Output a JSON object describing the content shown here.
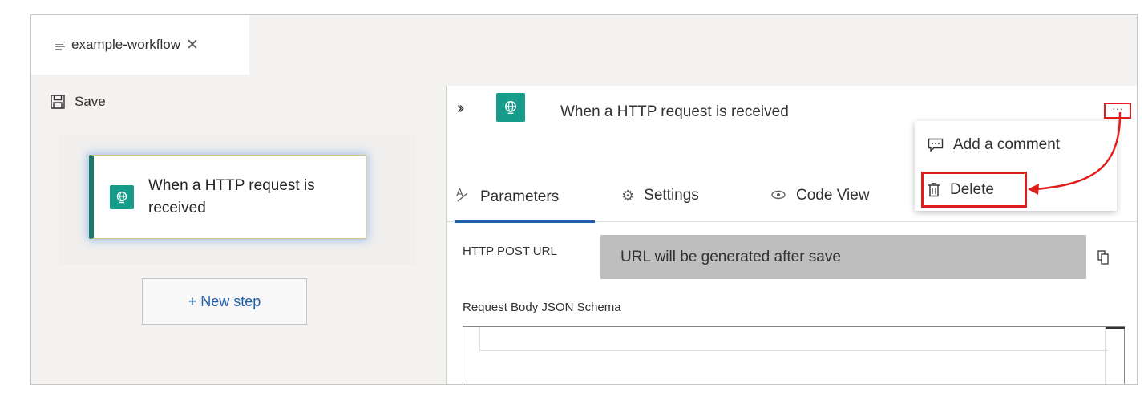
{
  "tab": {
    "title": "example-workflow",
    "close_glyph": "✕"
  },
  "toolbar": {
    "save_label": "Save"
  },
  "designer": {
    "trigger_card_title": "When a HTTP request is received",
    "new_step_label": "+ New step"
  },
  "details": {
    "collapse_glyph": "››",
    "title": "When a HTTP request is received",
    "more_glyph": "···",
    "tabs": [
      {
        "label": "Parameters",
        "icon": "parameters-icon"
      },
      {
        "label": "Settings",
        "icon": "settings-gear-icon"
      },
      {
        "label": "Code View",
        "icon": "eye-icon"
      }
    ],
    "http_post_url_label": "HTTP POST URL",
    "http_post_url_value": "URL will be generated after save",
    "schema_label": "Request Body JSON Schema"
  },
  "menu": {
    "items": [
      {
        "label": "Add a comment",
        "icon": "comment-icon"
      },
      {
        "label": "Delete",
        "icon": "trash-icon"
      }
    ]
  },
  "colors": {
    "accent": "#1e5fa8",
    "trigger_teal": "#179c8c",
    "highlight_red": "#e01e1e"
  }
}
